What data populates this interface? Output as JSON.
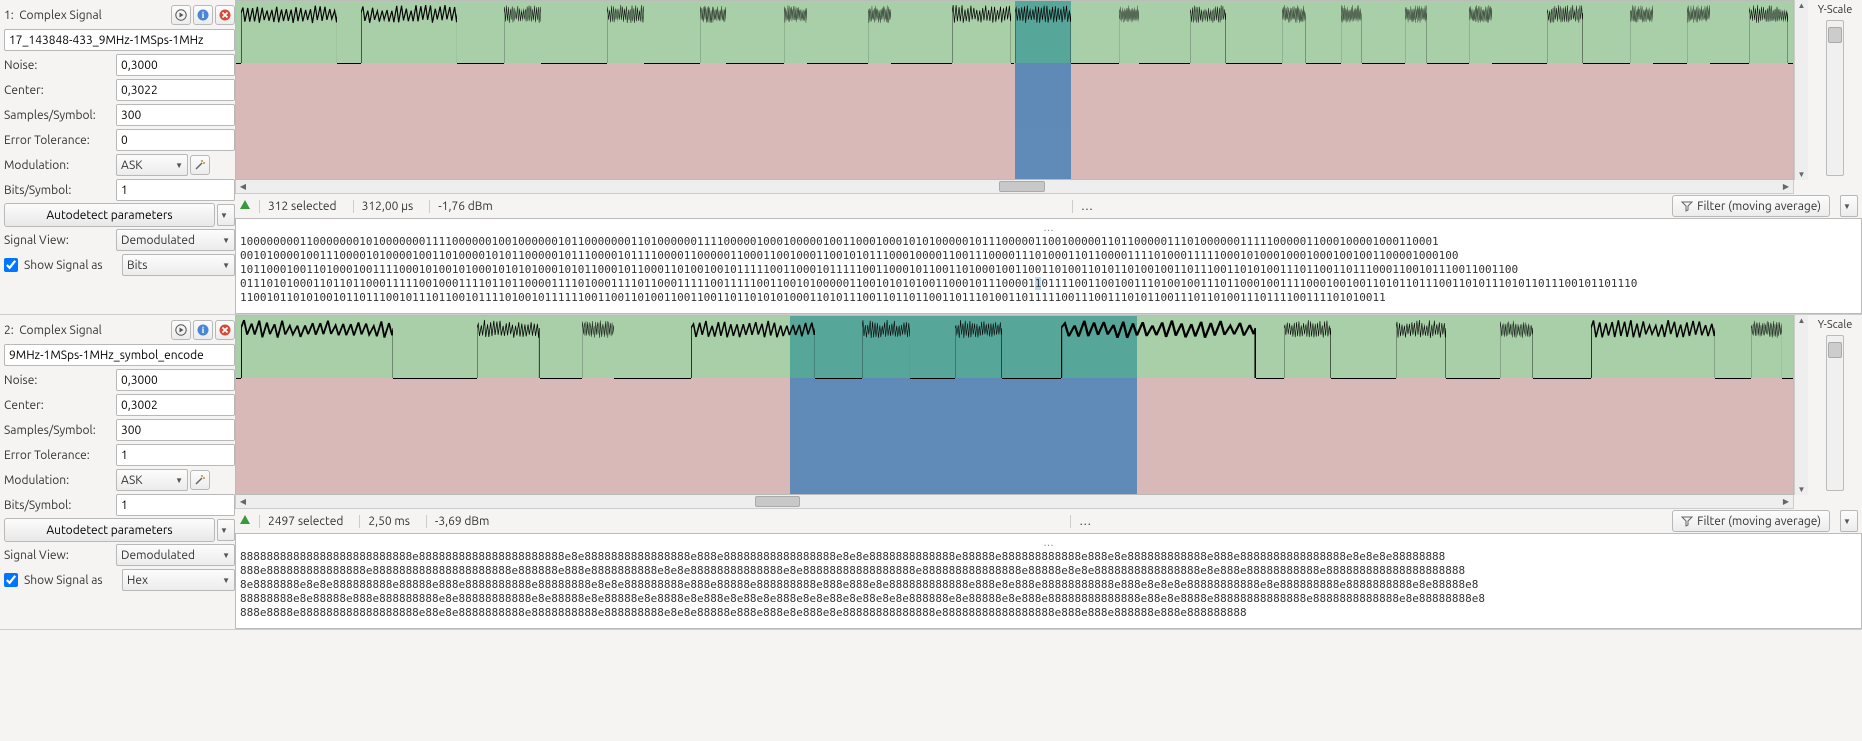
{
  "signals": [
    {
      "index_label": "1:",
      "name": "Complex Signal",
      "filename": "17_143848-433_9MHz-1MSps-1MHz",
      "noise_label": "Noise:",
      "noise": "0,3000",
      "center_label": "Center:",
      "center": "0,3022",
      "samples_label": "Samples/Symbol:",
      "samples": "300",
      "error_label": "Error Tolerance:",
      "error": "0",
      "mod_label": "Modulation:",
      "modulation": "ASK",
      "bits_label": "Bits/Symbol:",
      "bits": "1",
      "autodetect_label": "Autodetect parameters",
      "signalview_label": "Signal View:",
      "signalview": "Demodulated",
      "show_as_label": "Show Signal as",
      "show_as": "Bits",
      "yscale_label": "Y-Scale",
      "status": {
        "selected": "312  selected",
        "time": "312,00 µs",
        "power": "-1,76 dBm"
      },
      "filter_label": "Filter (moving average)",
      "data_lines": [
        "1000000001100000001010000000111100000010010000001011000000011010000001111000001000100000100110001000101010000010111000001100100000110110000011101000000111110000011000100001000110001",
        "0010100001001110000101000010011010000101011000001011100001011110000110000011000110010001100101011100010000110011100001110100011011000011110100011111000101000100010001001001100001000100",
        "1011000100110100010011110001010010100010101010001010110001011000110100100101111100110001011111001100010110011010001001100110100110101101001001101110011010100111011001101110001100101110011001100",
        "0111010100011011011000111110010001111011011000011110100011110110001111100111110011001010000011001010101001100010111000010011110011001001110100100111011000100111100010010011010110111001101011101011011100101101110",
        "11001011010100101101110010111011001011110100101111110011001101001100110011011010101000110101110011011011001101110100110111110011100111010110011101101001110111100111101010011"
      ],
      "selection": {
        "left_pct": 50.0,
        "width_pct": 3.6
      },
      "hscroll": {
        "left_pct": 49,
        "width_pct": 3
      },
      "bursts_pct": [
        {
          "l": 0.3,
          "w": 6.2
        },
        {
          "l": 8.0,
          "w": 6.2
        },
        {
          "l": 17.2,
          "w": 2.4
        },
        {
          "l": 23.8,
          "w": 2.4
        },
        {
          "l": 29.8,
          "w": 1.7
        },
        {
          "l": 35.2,
          "w": 1.5
        },
        {
          "l": 40.6,
          "w": 1.5
        },
        {
          "l": 46.0,
          "w": 3.8
        },
        {
          "l": 50.0,
          "w": 3.6
        },
        {
          "l": 56.7,
          "w": 1.3
        },
        {
          "l": 61.3,
          "w": 2.3
        },
        {
          "l": 67.2,
          "w": 1.5
        },
        {
          "l": 71.0,
          "w": 1.3
        },
        {
          "l": 75.1,
          "w": 1.4
        },
        {
          "l": 79.2,
          "w": 1.5
        },
        {
          "l": 84.2,
          "w": 2.3
        },
        {
          "l": 89.5,
          "w": 1.5
        },
        {
          "l": 93.2,
          "w": 1.5
        },
        {
          "l": 97.2,
          "w": 2.5
        }
      ]
    },
    {
      "index_label": "2:",
      "name": "Complex Signal",
      "filename": "9MHz-1MSps-1MHz_symbol_encode",
      "noise_label": "Noise:",
      "noise": "0,3000",
      "center_label": "Center:",
      "center": "0,3002",
      "samples_label": "Samples/Symbol:",
      "samples": "300",
      "error_label": "Error Tolerance:",
      "error": "1",
      "mod_label": "Modulation:",
      "modulation": "ASK",
      "bits_label": "Bits/Symbol:",
      "bits": "1",
      "autodetect_label": "Autodetect parameters",
      "signalview_label": "Signal View:",
      "signalview": "Demodulated",
      "show_as_label": "Show Signal as",
      "show_as": "Hex",
      "yscale_label": "Y-Scale",
      "status": {
        "selected": "2497  selected",
        "time": "2,50 ms",
        "power": "-3,69 dBm"
      },
      "filter_label": "Filter (moving average)",
      "data_lines": [
        "88888888888888888888888888e8888888888888888888888e8e8888888888888888e888e88888888888888888e8e8e8888888888888e88888e888888888888e888e8e888888888888e888e8888888888888888e8e8e8e88888888",
        "888e888888888888888e888888888888888888888e888888e888e8888888888e8e8e88888888888888e8e88888888888888888e888888888888888e88888e8e8e8888888888888888e8e888e88888888888e888888888888888888888",
        "8e8888888e8e8e888888888e88888e888e8888888888e88888888e8e8e888888888e888e88888e888888888e888e888e8e888888888888e888e8e888e88888888888e888e8e8e8e88888888888e8e888888888e8888888888e8e88888e8",
        "88888888e8e88888e888e888888888e8e88888888888e8e88888e8e88888e8e8888e8e888e8e88e8e888e8e8e88e8e88e8e8e888888e8e88888e8e888e88888888888888e88e8e8888e88888888888888e8888888888888e8e88888888e8",
        "888e8888e888888888888888888e88e8e8888888888e8888888888e888888888e8e8e88888e888e888e8e888e8e88888888888888e88888888888888888e888e888e888888e888e888888888"
      ],
      "selection": {
        "left_pct": 35.6,
        "width_pct": 22.3
      },
      "hscroll": {
        "left_pct": 33,
        "width_pct": 3
      },
      "bursts_pct": [
        {
          "l": 0.3,
          "w": 9.8
        },
        {
          "l": 15.5,
          "w": 4.0
        },
        {
          "l": 22.2,
          "w": 2.1
        },
        {
          "l": 29.2,
          "w": 8.0
        },
        {
          "l": 40.2,
          "w": 3.1
        },
        {
          "l": 46.2,
          "w": 3.0
        },
        {
          "l": 53.0,
          "w": 12.5
        },
        {
          "l": 67.3,
          "w": 3.0
        },
        {
          "l": 74.5,
          "w": 3.2
        },
        {
          "l": 81.2,
          "w": 2.1
        },
        {
          "l": 87.0,
          "w": 8.0
        },
        {
          "l": 97.3,
          "w": 2.0
        }
      ]
    }
  ]
}
